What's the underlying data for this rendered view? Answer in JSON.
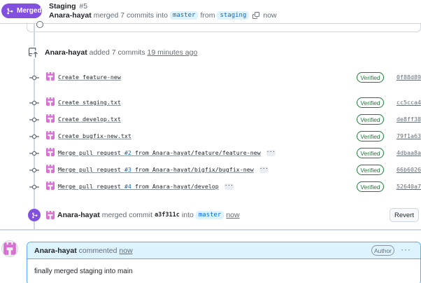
{
  "header": {
    "status_badge": "Merged",
    "title": "Staging",
    "number": "#5",
    "author": "Anara-hayat",
    "merged_text": "merged 7 commits into",
    "base_branch": "master",
    "from_text": "from",
    "head_branch": "staging",
    "time": "now"
  },
  "commits_event": {
    "author": "Anara-hayat",
    "action": "added 7 commits",
    "time": "19 minutes ago"
  },
  "commits": [
    {
      "message": "Create feature-new",
      "pr_number": "",
      "message_tail": "",
      "has_ellipsis": false,
      "verified": "Verified",
      "sha": "0f88d89"
    },
    {
      "message": "Create staging.txt",
      "pr_number": "",
      "message_tail": "",
      "has_ellipsis": false,
      "verified": "Verified",
      "sha": "cc5cca4"
    },
    {
      "message": "Create develop.txt",
      "pr_number": "",
      "message_tail": "",
      "has_ellipsis": false,
      "verified": "Verified",
      "sha": "de8ff38"
    },
    {
      "message": "Create bugfix-new.txt",
      "pr_number": "",
      "message_tail": "",
      "has_ellipsis": false,
      "verified": "Verified",
      "sha": "79f1a63"
    },
    {
      "message": "Merge pull request ",
      "pr_number": "#2",
      "message_tail": " from Anara-hayat/feature/feature-new",
      "has_ellipsis": true,
      "verified": "Verified",
      "sha": "4dbaa8a"
    },
    {
      "message": "Merge pull request ",
      "pr_number": "#3",
      "message_tail": " from Anara-hayat/bigfix/bugfix-new",
      "has_ellipsis": true,
      "verified": "Verified",
      "sha": "66b6026"
    },
    {
      "message": "Merge pull request ",
      "pr_number": "#4",
      "message_tail": " from Anara-hayat/develop",
      "has_ellipsis": true,
      "verified": "Verified",
      "sha": "52640a7"
    }
  ],
  "merge_event": {
    "author": "Anara-hayat",
    "action": "merged commit",
    "sha": "a3f311c",
    "into": "into",
    "branch": "master",
    "time": "now",
    "revert_label": "Revert"
  },
  "comment": {
    "author": "Anara-hayat",
    "action": "commented",
    "time": "now",
    "badge": "Author",
    "more": "···",
    "body": "finally merged staging into main"
  },
  "colors": {
    "merged_purple": "#8250df",
    "verified_green": "#1a7f37",
    "link_blue": "#0969da",
    "comment_header_bg": "#ddf4ff"
  },
  "icons": {
    "merge": "git-merge-icon",
    "copy": "copy-icon",
    "commits": "repo-push-icon",
    "commit": "git-commit-icon",
    "avatar": "identicon"
  }
}
